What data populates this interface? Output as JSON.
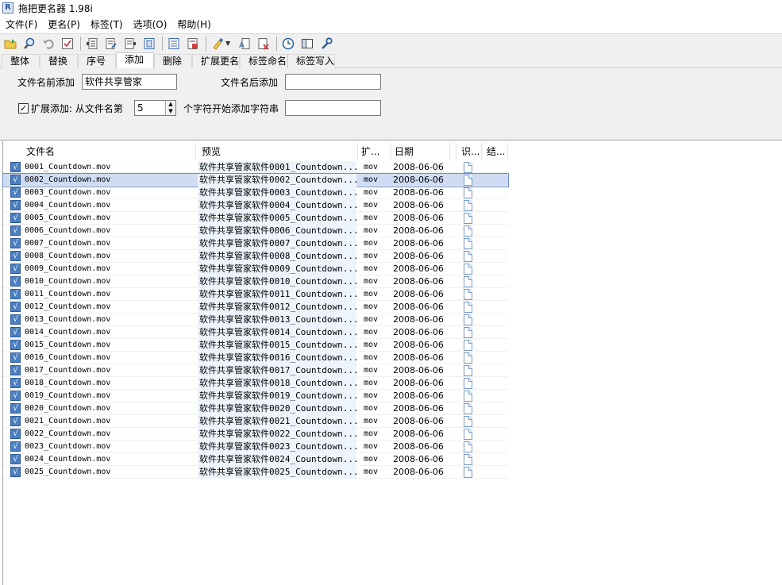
{
  "window": {
    "title": "拖把更名器 1.98i",
    "icon": "R"
  },
  "menu": [
    "文件(F)",
    "更名(P)",
    "标签(T)",
    "选项(O)",
    "帮助(H)"
  ],
  "toolbar": {
    "icons": [
      "folder-open-icon",
      "search-icon",
      "undo-icon",
      "checkbox-icon",
      "doc-left-icon",
      "doc-edit-icon",
      "doc-right-icon",
      "doc-frame-icon",
      "list-icon",
      "doc-red-icon",
      "paint-icon",
      "doc-a-icon",
      "doc-x-icon",
      "clock-icon",
      "panel-icon",
      "tools-icon"
    ]
  },
  "tabs": [
    "整体",
    "替换",
    "序号",
    "添加",
    "删除",
    "扩展更名",
    "标签命名",
    "标签写入"
  ],
  "active_tab": "添加",
  "panel": {
    "prefix_label": "文件名前添加",
    "prefix_value": "软件共享管家",
    "suffix_label": "文件名后添加",
    "suffix_value": "",
    "ext_add_label": "扩展添加: 从文件名第",
    "ext_add_checked": true,
    "position_value": "5",
    "ext_add_tail": "个字符开始添加字符串",
    "ext_value": ""
  },
  "columns": [
    "文件名",
    "预览",
    "扩...",
    "日期",
    "识...",
    "结..."
  ],
  "rows": [
    {
      "name": "0001_Countdown.mov",
      "preview": "软件共享管家软件0001_Countdown....",
      "ext": "mov",
      "date": "2008-06-06"
    },
    {
      "name": "0002_Countdown.mov",
      "preview": "软件共享管家软件0002_Countdown....",
      "ext": "mov",
      "date": "2008-06-06"
    },
    {
      "name": "0003_Countdown.mov",
      "preview": "软件共享管家软件0003_Countdown....",
      "ext": "mov",
      "date": "2008-06-06"
    },
    {
      "name": "0004_Countdown.mov",
      "preview": "软件共享管家软件0004_Countdown....",
      "ext": "mov",
      "date": "2008-06-06"
    },
    {
      "name": "0005_Countdown.mov",
      "preview": "软件共享管家软件0005_Countdown....",
      "ext": "mov",
      "date": "2008-06-06"
    },
    {
      "name": "0006_Countdown.mov",
      "preview": "软件共享管家软件0006_Countdown....",
      "ext": "mov",
      "date": "2008-06-06"
    },
    {
      "name": "0007_Countdown.mov",
      "preview": "软件共享管家软件0007_Countdown....",
      "ext": "mov",
      "date": "2008-06-06"
    },
    {
      "name": "0008_Countdown.mov",
      "preview": "软件共享管家软件0008_Countdown....",
      "ext": "mov",
      "date": "2008-06-06"
    },
    {
      "name": "0009_Countdown.mov",
      "preview": "软件共享管家软件0009_Countdown....",
      "ext": "mov",
      "date": "2008-06-06"
    },
    {
      "name": "0010_Countdown.mov",
      "preview": "软件共享管家软件0010_Countdown....",
      "ext": "mov",
      "date": "2008-06-06"
    },
    {
      "name": "0011_Countdown.mov",
      "preview": "软件共享管家软件0011_Countdown....",
      "ext": "mov",
      "date": "2008-06-06"
    },
    {
      "name": "0012_Countdown.mov",
      "preview": "软件共享管家软件0012_Countdown....",
      "ext": "mov",
      "date": "2008-06-06"
    },
    {
      "name": "0013_Countdown.mov",
      "preview": "软件共享管家软件0013_Countdown....",
      "ext": "mov",
      "date": "2008-06-06"
    },
    {
      "name": "0014_Countdown.mov",
      "preview": "软件共享管家软件0014_Countdown....",
      "ext": "mov",
      "date": "2008-06-06"
    },
    {
      "name": "0015_Countdown.mov",
      "preview": "软件共享管家软件0015_Countdown....",
      "ext": "mov",
      "date": "2008-06-06"
    },
    {
      "name": "0016_Countdown.mov",
      "preview": "软件共享管家软件0016_Countdown....",
      "ext": "mov",
      "date": "2008-06-06"
    },
    {
      "name": "0017_Countdown.mov",
      "preview": "软件共享管家软件0017_Countdown....",
      "ext": "mov",
      "date": "2008-06-06"
    },
    {
      "name": "0018_Countdown.mov",
      "preview": "软件共享管家软件0018_Countdown....",
      "ext": "mov",
      "date": "2008-06-06"
    },
    {
      "name": "0019_Countdown.mov",
      "preview": "软件共享管家软件0019_Countdown....",
      "ext": "mov",
      "date": "2008-06-06"
    },
    {
      "name": "0020_Countdown.mov",
      "preview": "软件共享管家软件0020_Countdown....",
      "ext": "mov",
      "date": "2008-06-06"
    },
    {
      "name": "0021_Countdown.mov",
      "preview": "软件共享管家软件0021_Countdown....",
      "ext": "mov",
      "date": "2008-06-06"
    },
    {
      "name": "0022_Countdown.mov",
      "preview": "软件共享管家软件0022_Countdown....",
      "ext": "mov",
      "date": "2008-06-06"
    },
    {
      "name": "0023_Countdown.mov",
      "preview": "软件共享管家软件0023_Countdown....",
      "ext": "mov",
      "date": "2008-06-06"
    },
    {
      "name": "0024_Countdown.mov",
      "preview": "软件共享管家软件0024_Countdown....",
      "ext": "mov",
      "date": "2008-06-06"
    },
    {
      "name": "0025_Countdown.mov",
      "preview": "软件共享管家软件0025_Countdown....",
      "ext": "mov",
      "date": "2008-06-06"
    }
  ],
  "selected_row": 1,
  "colors": {
    "selection": "#cfdcf3",
    "selection_border": "#6b8ccc",
    "check_blue": "#4a7fc2",
    "panel_bg": "#f0f0f0"
  }
}
